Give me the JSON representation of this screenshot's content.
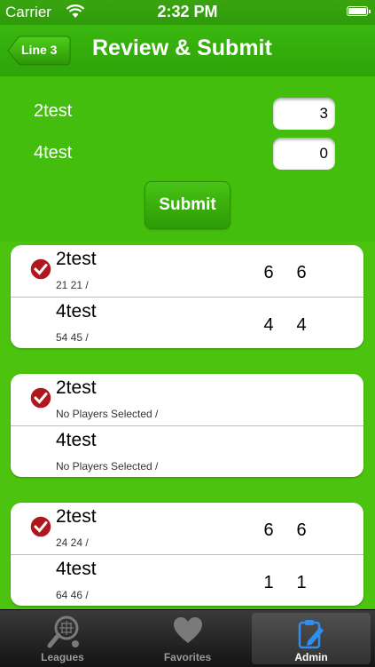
{
  "status_bar": {
    "carrier": "Carrier",
    "time": "2:32 PM"
  },
  "nav": {
    "back_label": "Line 3",
    "title": "Review & Submit"
  },
  "form": {
    "rows": [
      {
        "label": "2test",
        "value": "3"
      },
      {
        "label": "4test",
        "value": "0"
      }
    ],
    "submit_label": "Submit"
  },
  "matches": [
    {
      "players": [
        {
          "name": "2test",
          "sub": "21 21  /",
          "scores": [
            "6",
            "6"
          ],
          "checked": true
        },
        {
          "name": "4test",
          "sub": "54 45  /",
          "scores": [
            "4",
            "4"
          ],
          "checked": false
        }
      ]
    },
    {
      "players": [
        {
          "name": "2test",
          "sub": "No Players Selected /",
          "scores": [
            "",
            ""
          ],
          "checked": true
        },
        {
          "name": "4test",
          "sub": "No Players Selected /",
          "scores": [
            "",
            ""
          ],
          "checked": false
        }
      ]
    },
    {
      "players": [
        {
          "name": "2test",
          "sub": "24 24  /",
          "scores": [
            "6",
            "6"
          ],
          "checked": true
        },
        {
          "name": "4test",
          "sub": "64 46  /",
          "scores": [
            "1",
            "1"
          ],
          "checked": false
        }
      ]
    }
  ],
  "tabs": [
    {
      "label": "Leagues",
      "icon": "tennis-racket-icon",
      "active": false
    },
    {
      "label": "Favorites",
      "icon": "heart-icon",
      "active": false
    },
    {
      "label": "Admin",
      "icon": "clipboard-edit-icon",
      "active": true
    }
  ],
  "colors": {
    "accent": "#3ab70f",
    "check": "#b0161e"
  }
}
